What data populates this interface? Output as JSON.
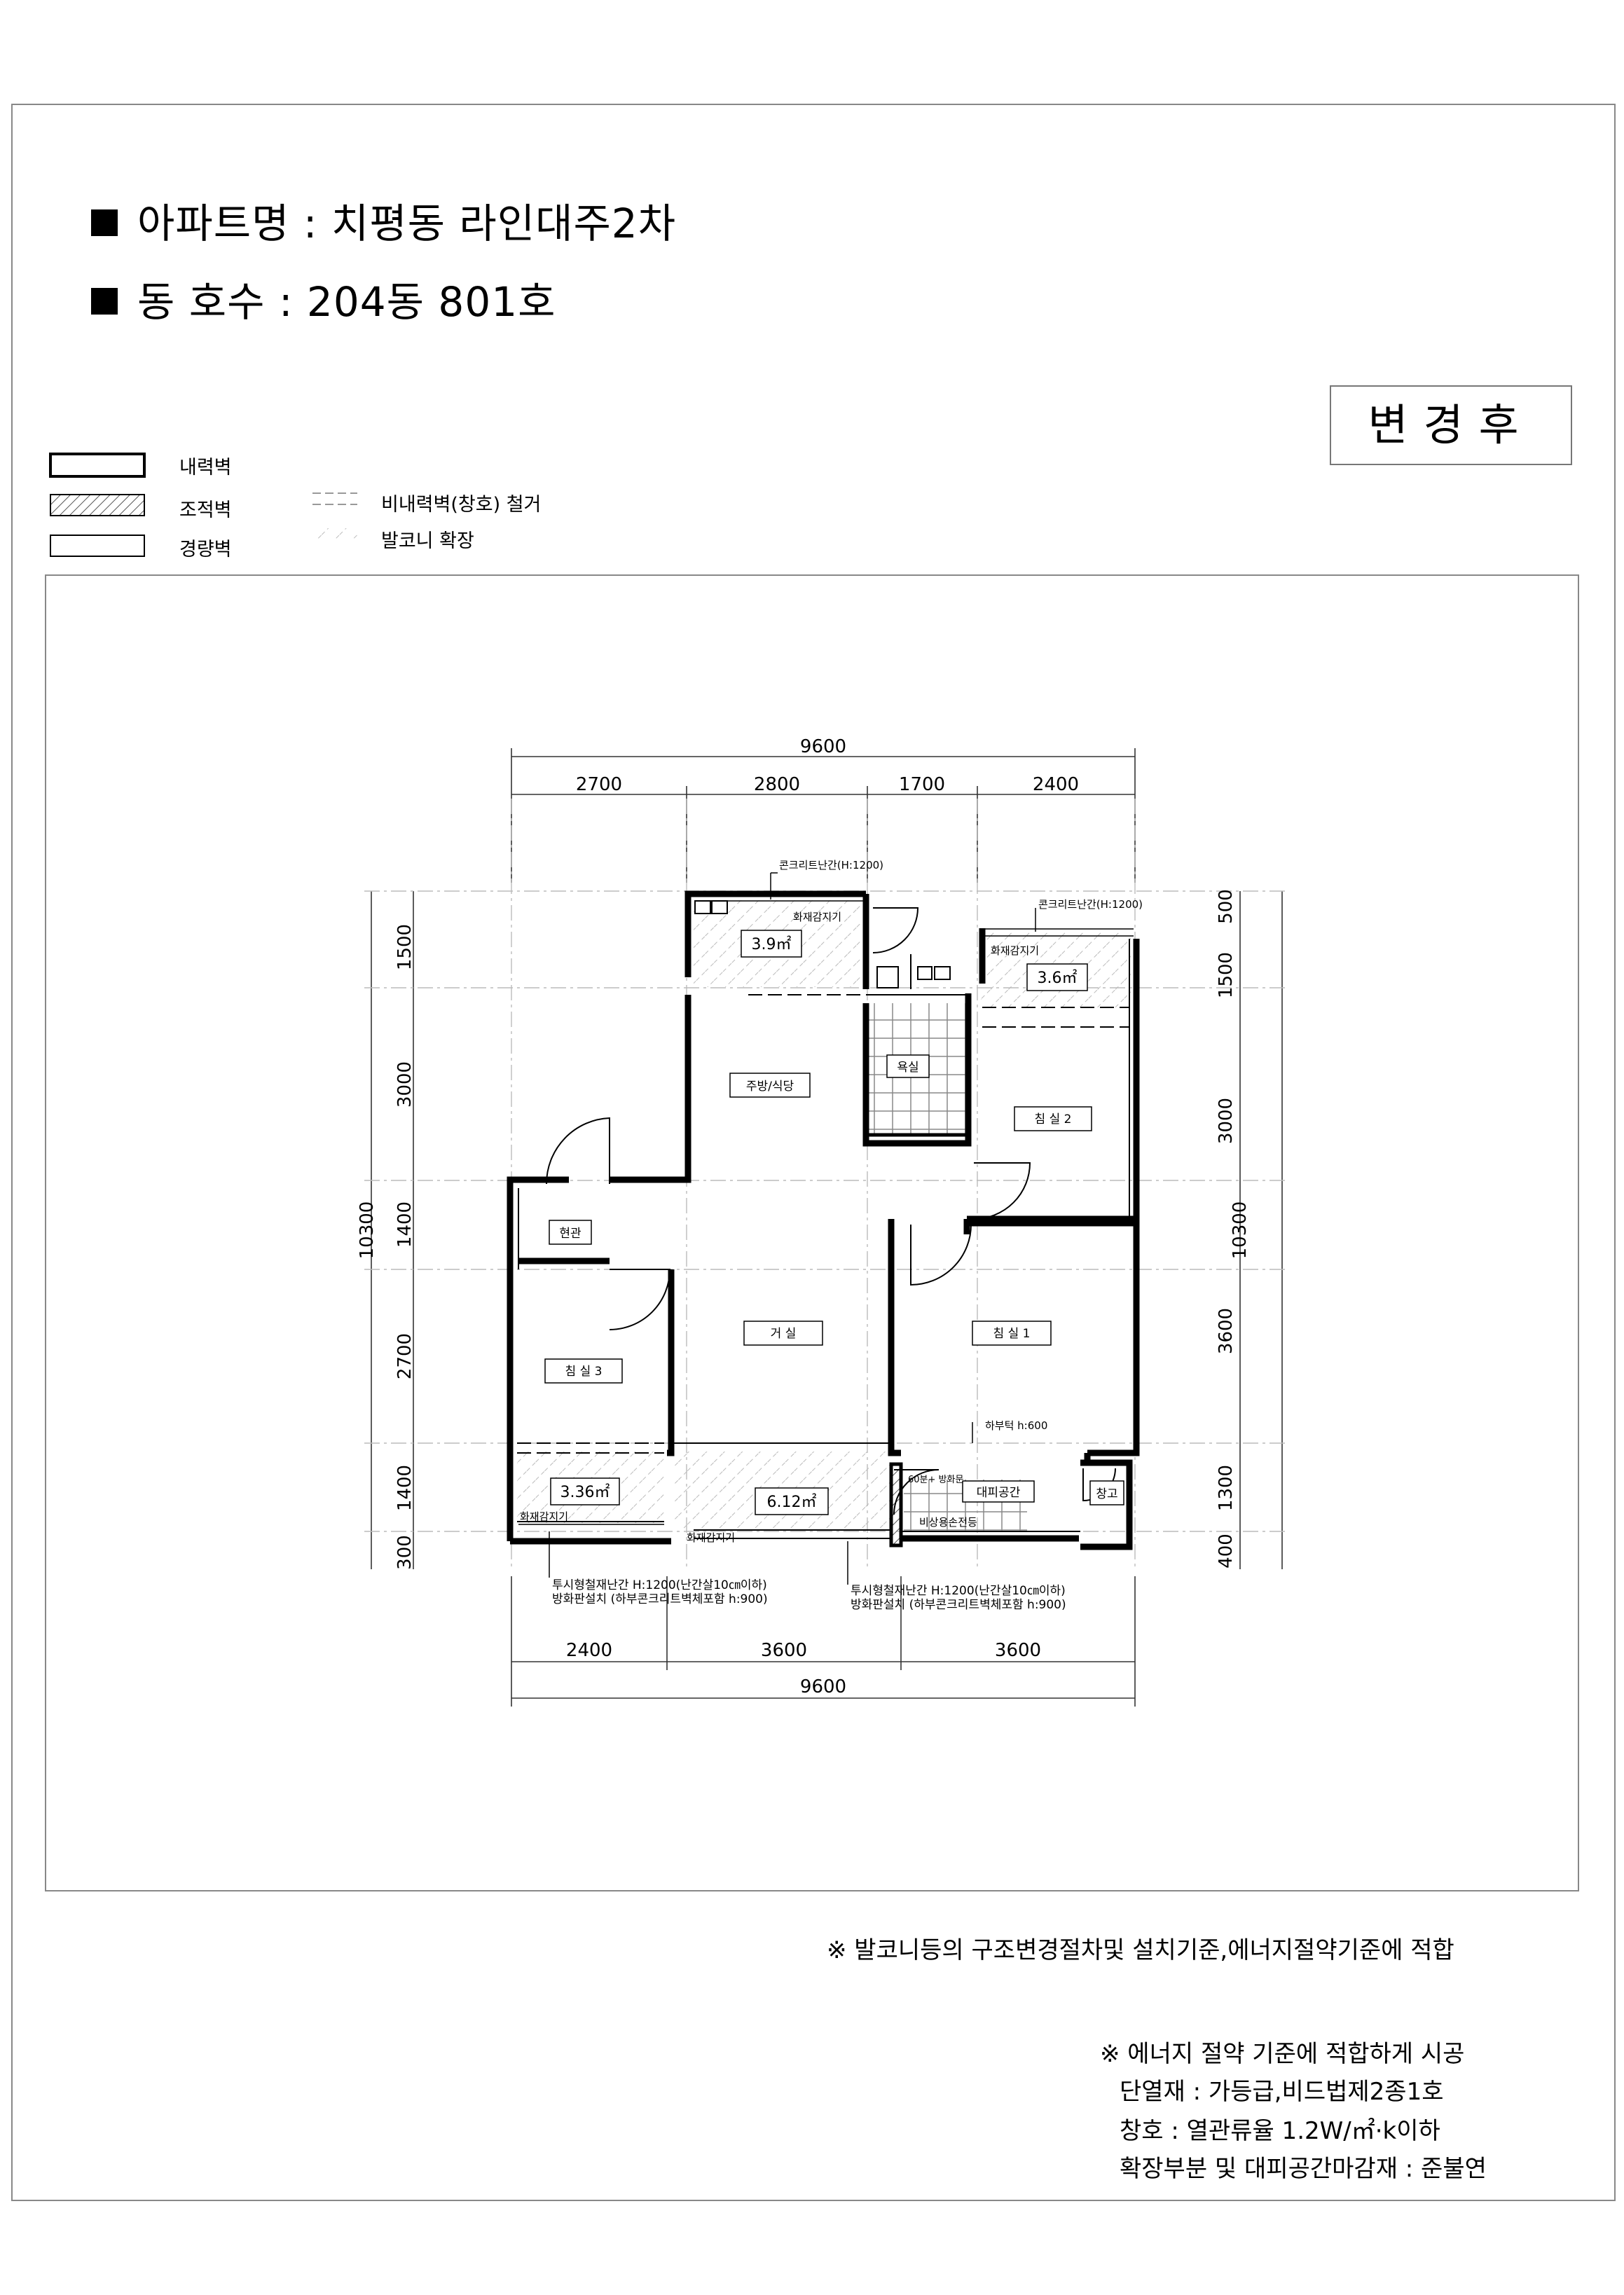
{
  "header": {
    "apartment_line": "아파트명 : 치평동 라인대주2차",
    "unit_line": "동 호수  : 204동 801호",
    "badge": "변경후"
  },
  "legend": {
    "items": [
      {
        "label": "내력벽",
        "swatch": "thick-outline"
      },
      {
        "label": "조적벽",
        "swatch": "hatched"
      },
      {
        "label": "경량벽",
        "swatch": "thin-outline"
      },
      {
        "label": "비내력벽(창호) 철거",
        "swatch": "dashed"
      },
      {
        "label": "발코니 확장",
        "swatch": "diagonal-hatch"
      }
    ]
  },
  "dimensions": {
    "top_total": "9600",
    "top_segments": [
      "2700",
      "2800",
      "1700",
      "2400"
    ],
    "bottom_segments": [
      "2400",
      "3600",
      "3600"
    ],
    "bottom_total": "9600",
    "left_total": "10300",
    "left_segments": [
      "1500",
      "3000",
      "1400",
      "2700",
      "1400",
      "300"
    ],
    "right_total": "10300",
    "right_segments": [
      "500",
      "1500",
      "3000",
      "3600",
      "1300",
      "400"
    ]
  },
  "rooms": {
    "kitchen": "주방/식당",
    "bath": "욕실",
    "bedroom2": "침 실 2",
    "entrance": "현관",
    "living": "거 실",
    "bedroom1": "침 실 1",
    "bedroom3": "침 실 3",
    "refuge": "대피공간",
    "storage": "창고"
  },
  "areas": {
    "balcony_top_left": "3.9㎡",
    "balcony_top_right": "3.6㎡",
    "balcony_bottom_left": "3.36㎡",
    "balcony_bottom_mid": "6.12㎡"
  },
  "annotations": {
    "railing_top": "콘크리트난간(H:1200)",
    "railing_right": "콘크리트난간(H:1200)",
    "detector": "화재감지기",
    "lower_door": "하부턱 h:600",
    "fire_door": "60분+ 방화문",
    "emergency_light": "비상용손전등",
    "railing_note_left": "투시형철재난간 H:1200(난간살10㎝이하)",
    "fireboard_left": "방화판설치 (하부콘크리트벽체포함 h:900)",
    "railing_note_right": "투시형철재난간 H:1200(난간살10㎝이하)",
    "fireboard_right": "방화판설치 (하부콘크리트벽체포함 h:900)"
  },
  "notes": {
    "compliance": "※ 발코니등의 구조변경절차및 설치기준,에너지절약기준에 적합",
    "energy_title": "※ 에너지 절약 기준에 적합하게 시공",
    "insulation": "단열재 : 가등급,비드법제2종1호",
    "window": "창호 : 열관류율 1.2W/㎡·k이하",
    "finish": "확장부분 및 대피공간마감재 : 준불연"
  }
}
